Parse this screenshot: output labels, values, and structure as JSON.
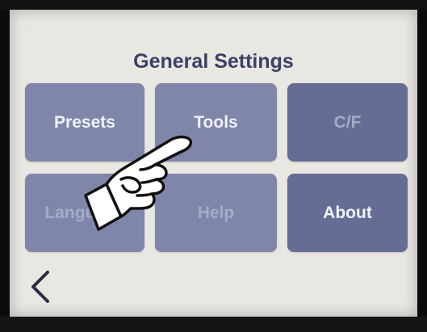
{
  "screen": {
    "title": "General Settings"
  },
  "tiles": [
    {
      "label": "Presets",
      "state": "enabled"
    },
    {
      "label": "Tools",
      "state": "enabled"
    },
    {
      "label": "C/F",
      "state": "disabled"
    },
    {
      "label": "Language",
      "state": "disabled"
    },
    {
      "label": "Help",
      "state": "disabled"
    },
    {
      "label": "About",
      "state": "enabled"
    }
  ],
  "nav": {
    "back_icon": "chevron-left-icon"
  },
  "overlay": {
    "pointer_icon": "pointing-hand-icon"
  },
  "colors": {
    "screen_bg": "#e8e7e2",
    "tile": "#7f86aa",
    "tile_dark": "#666d94",
    "title_text": "#3b4066",
    "enabled_text": "#f2f2f6",
    "disabled_text": "#a7acc6"
  }
}
